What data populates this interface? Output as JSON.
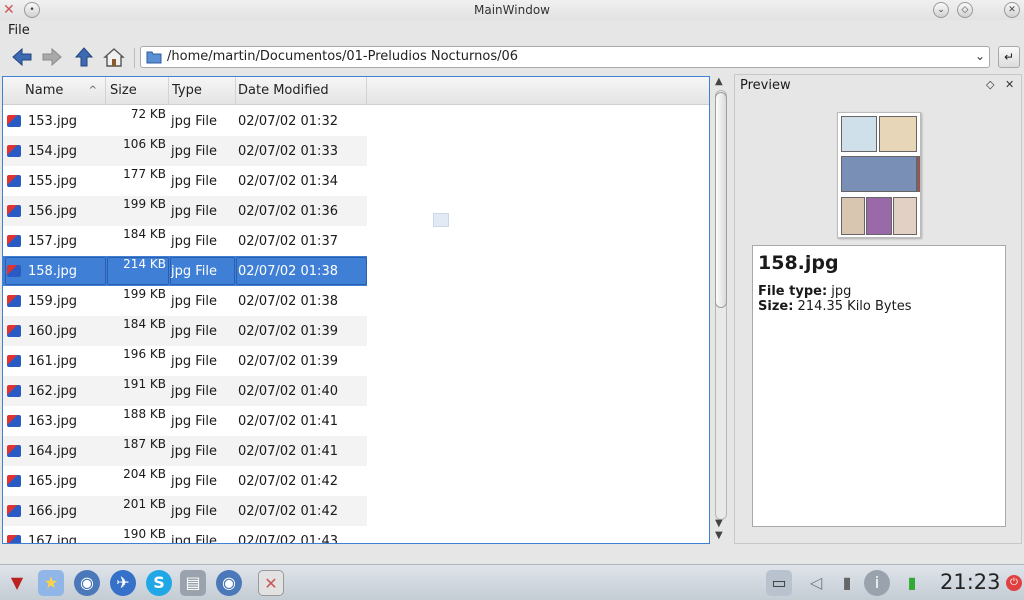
{
  "window": {
    "title": "MainWindow"
  },
  "menu": {
    "file": "File"
  },
  "toolbar": {
    "path": "/home/martin/Documentos/01-Preludios Nocturnos/06"
  },
  "columns": {
    "name": "Name",
    "size": "Size",
    "type": "Type",
    "date": "Date Modified"
  },
  "files": [
    {
      "name": "153.jpg",
      "size": "72 KB",
      "type": "jpg File",
      "date": "02/07/02 01:32"
    },
    {
      "name": "154.jpg",
      "size": "106 KB",
      "type": "jpg File",
      "date": "02/07/02 01:33"
    },
    {
      "name": "155.jpg",
      "size": "177 KB",
      "type": "jpg File",
      "date": "02/07/02 01:34"
    },
    {
      "name": "156.jpg",
      "size": "199 KB",
      "type": "jpg File",
      "date": "02/07/02 01:36"
    },
    {
      "name": "157.jpg",
      "size": "184 KB",
      "type": "jpg File",
      "date": "02/07/02 01:37"
    },
    {
      "name": "158.jpg",
      "size": "214 KB",
      "type": "jpg File",
      "date": "02/07/02 01:38"
    },
    {
      "name": "159.jpg",
      "size": "199 KB",
      "type": "jpg File",
      "date": "02/07/02 01:38"
    },
    {
      "name": "160.jpg",
      "size": "184 KB",
      "type": "jpg File",
      "date": "02/07/02 01:39"
    },
    {
      "name": "161.jpg",
      "size": "196 KB",
      "type": "jpg File",
      "date": "02/07/02 01:39"
    },
    {
      "name": "162.jpg",
      "size": "191 KB",
      "type": "jpg File",
      "date": "02/07/02 01:40"
    },
    {
      "name": "163.jpg",
      "size": "188 KB",
      "type": "jpg File",
      "date": "02/07/02 01:41"
    },
    {
      "name": "164.jpg",
      "size": "187 KB",
      "type": "jpg File",
      "date": "02/07/02 01:41"
    },
    {
      "name": "165.jpg",
      "size": "204 KB",
      "type": "jpg File",
      "date": "02/07/02 01:42"
    },
    {
      "name": "166.jpg",
      "size": "201 KB",
      "type": "jpg File",
      "date": "02/07/02 01:42"
    },
    {
      "name": "167.jpg",
      "size": "190 KB",
      "type": "jpg File",
      "date": "02/07/02 01:43"
    }
  ],
  "selected_index": 5,
  "preview": {
    "title": "Preview",
    "filename": "158.jpg",
    "file_type_label": "File type:",
    "file_type": "jpg",
    "size_label": "Size:",
    "size": "214.35 Kilo Bytes"
  },
  "taskbar": {
    "clock": "21:23"
  },
  "colors": {
    "selection": "#3f7fd6",
    "alt_row": "#f3f3f3"
  }
}
